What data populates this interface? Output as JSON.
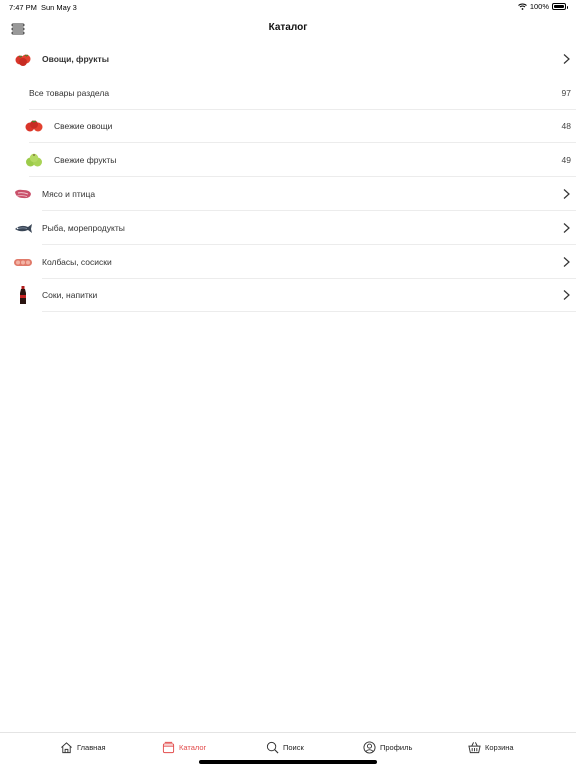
{
  "status_bar": {
    "time": "7:47 PM",
    "date": "Sun May 3",
    "battery": "100%",
    "icons": [
      "wifi-icon",
      "battery-icon"
    ]
  },
  "header": {
    "title": "Каталог",
    "menu_icon": "hamburger-menu-icon"
  },
  "catalog": {
    "expanded_category": {
      "label": "Овощи, фрукты",
      "icon": "tomatoes-icon",
      "all_items": {
        "label": "Все товары раздела",
        "count": "97"
      },
      "subcategories": [
        {
          "label": "Свежие овощи",
          "count": "48",
          "icon": "tomatoes-icon"
        },
        {
          "label": "Свежие фрукты",
          "count": "49",
          "icon": "green-apples-icon"
        }
      ]
    },
    "categories": [
      {
        "label": "Мясо и птица",
        "icon": "meat-icon"
      },
      {
        "label": "Рыба, морепродукты",
        "icon": "fish-icon"
      },
      {
        "label": "Колбасы, сосиски",
        "icon": "sausages-icon"
      },
      {
        "label": "Соки, напитки",
        "icon": "soda-bottle-icon"
      }
    ]
  },
  "tab_bar": {
    "active_color": "#e24b4b",
    "tabs": [
      {
        "label": "Главная",
        "icon": "home-icon",
        "active": false
      },
      {
        "label": "Каталог",
        "icon": "catalog-icon",
        "active": true
      },
      {
        "label": "Поиск",
        "icon": "search-icon",
        "active": false
      },
      {
        "label": "Профиль",
        "icon": "profile-icon",
        "active": false
      },
      {
        "label": "Корзина",
        "icon": "basket-icon",
        "active": false
      }
    ]
  }
}
